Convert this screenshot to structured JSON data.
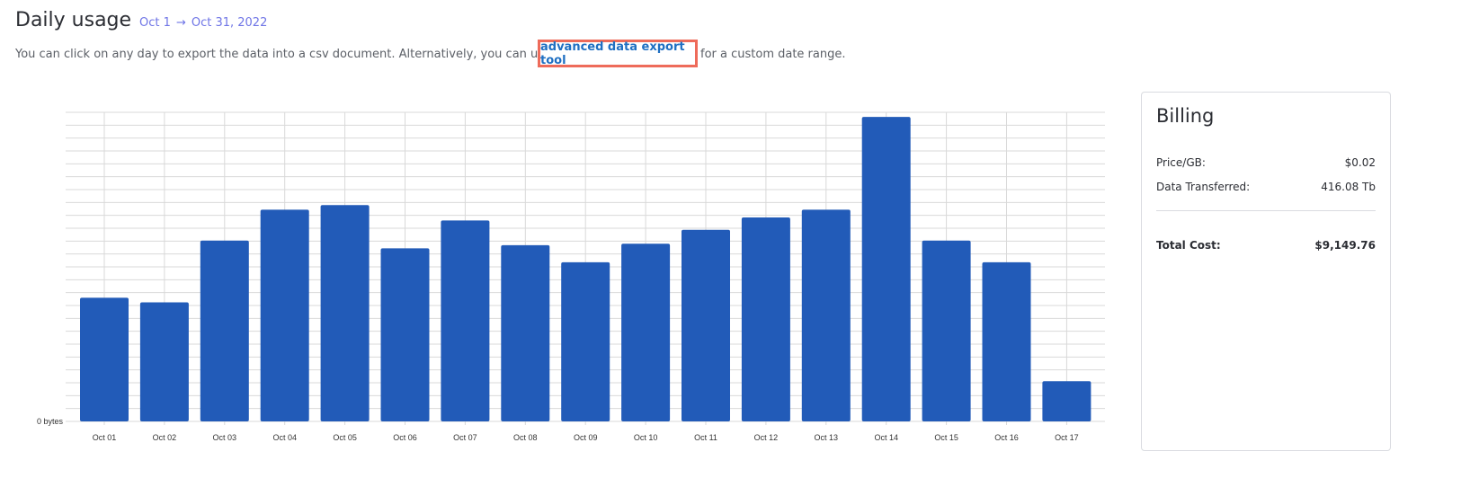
{
  "header": {
    "title": "Daily usage",
    "date_start": "Oct 1",
    "arrow": "→",
    "date_end": "Oct 31, 2022"
  },
  "description": {
    "before": "You can click on any day to export the data into a csv document. Alternatively, you can use our",
    "link": "advanced data export tool",
    "after": "for a custom date range."
  },
  "chart_data": {
    "type": "bar",
    "categories": [
      "Oct 01",
      "Oct 02",
      "Oct 03",
      "Oct 04",
      "Oct 05",
      "Oct 06",
      "Oct 07",
      "Oct 08",
      "Oct 09",
      "Oct 10",
      "Oct 11",
      "Oct 12",
      "Oct 13",
      "Oct 14",
      "Oct 15",
      "Oct 16",
      "Oct 17"
    ],
    "values": [
      40,
      38.5,
      58.5,
      68.5,
      70,
      56,
      65,
      57,
      51.5,
      57.5,
      62,
      66,
      68.5,
      98.5,
      58.5,
      51.5,
      13
    ],
    "ylabel": "",
    "y_tick_label": "0 bytes",
    "ylim": [
      0,
      100
    ],
    "grid": true,
    "bar_color": "#225bb8"
  },
  "billing": {
    "title": "Billing",
    "rows": [
      {
        "label": "Price/GB:",
        "value": "$0.02"
      },
      {
        "label": "Data Transferred:",
        "value": "416.08 Tb"
      }
    ],
    "total_label": "Total Cost:",
    "total_value": "$9,149.76"
  },
  "colors": {
    "accent": "#6f75e6",
    "link": "#1f6fc2",
    "highlight_border": "#ee6b5a"
  }
}
